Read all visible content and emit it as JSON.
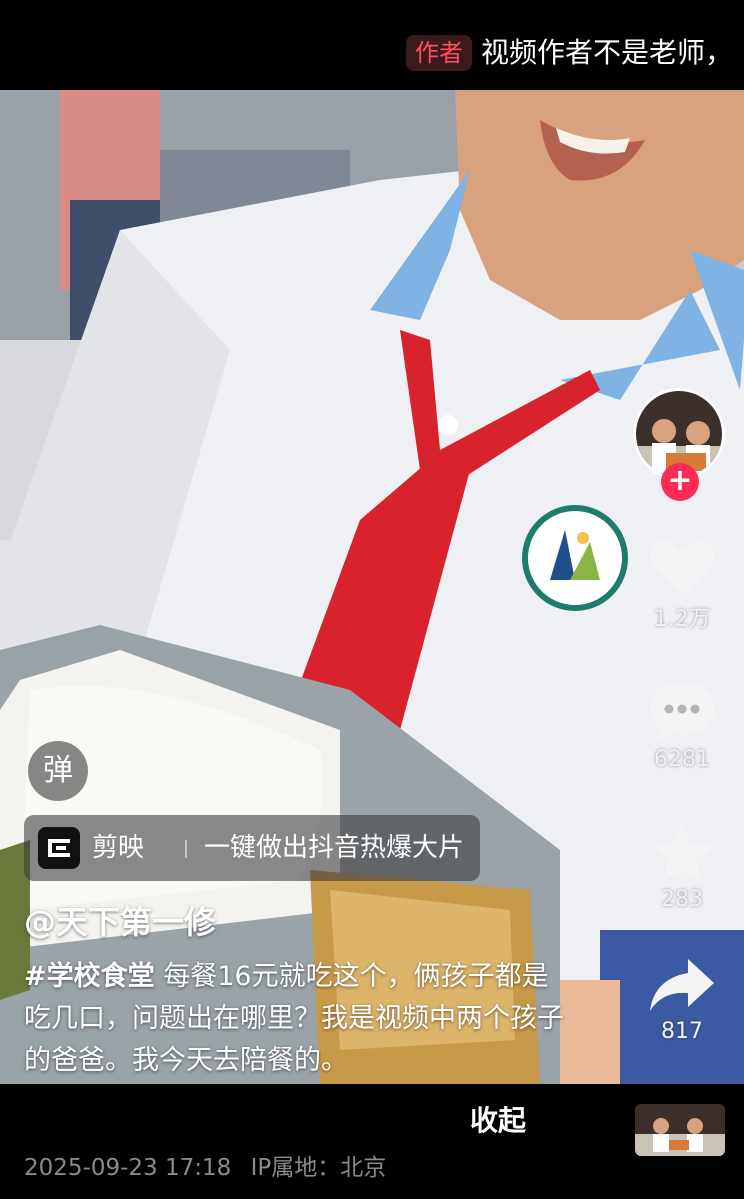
{
  "top_comment": {
    "author_badge": "作者",
    "text": "视频作者不是老师，"
  },
  "actions": {
    "like_count": "1.2万",
    "comment_count": "6281",
    "favorite_count": "283",
    "share_count": "817"
  },
  "danmu_label": "弹",
  "capcut_banner": {
    "app_name": "剪映",
    "slogan": "一键做出抖音热爆大片"
  },
  "post": {
    "author": "@天下第一修",
    "hashtag": "#学校食堂",
    "caption": " 每餐16元就吃这个，俩孩子都是吃几口，问题出在哪里？我是视频中两个孩子的爸爸。我今天去陪餐的。"
  },
  "bottom": {
    "collapse_label": "收起",
    "date": "2025-09-23 17:18",
    "ip_location": "IP属地：北京"
  },
  "colors": {
    "accent_red": "#fe2c55",
    "author_badge_red": "#ff4d5e",
    "scarf_red": "#d8232f",
    "collar_blue": "#7fb3e3"
  },
  "icons": [
    "heart-icon",
    "comment-bubble-icon",
    "star-icon",
    "share-arrow-icon",
    "plus-icon",
    "capcut-logo-icon"
  ]
}
